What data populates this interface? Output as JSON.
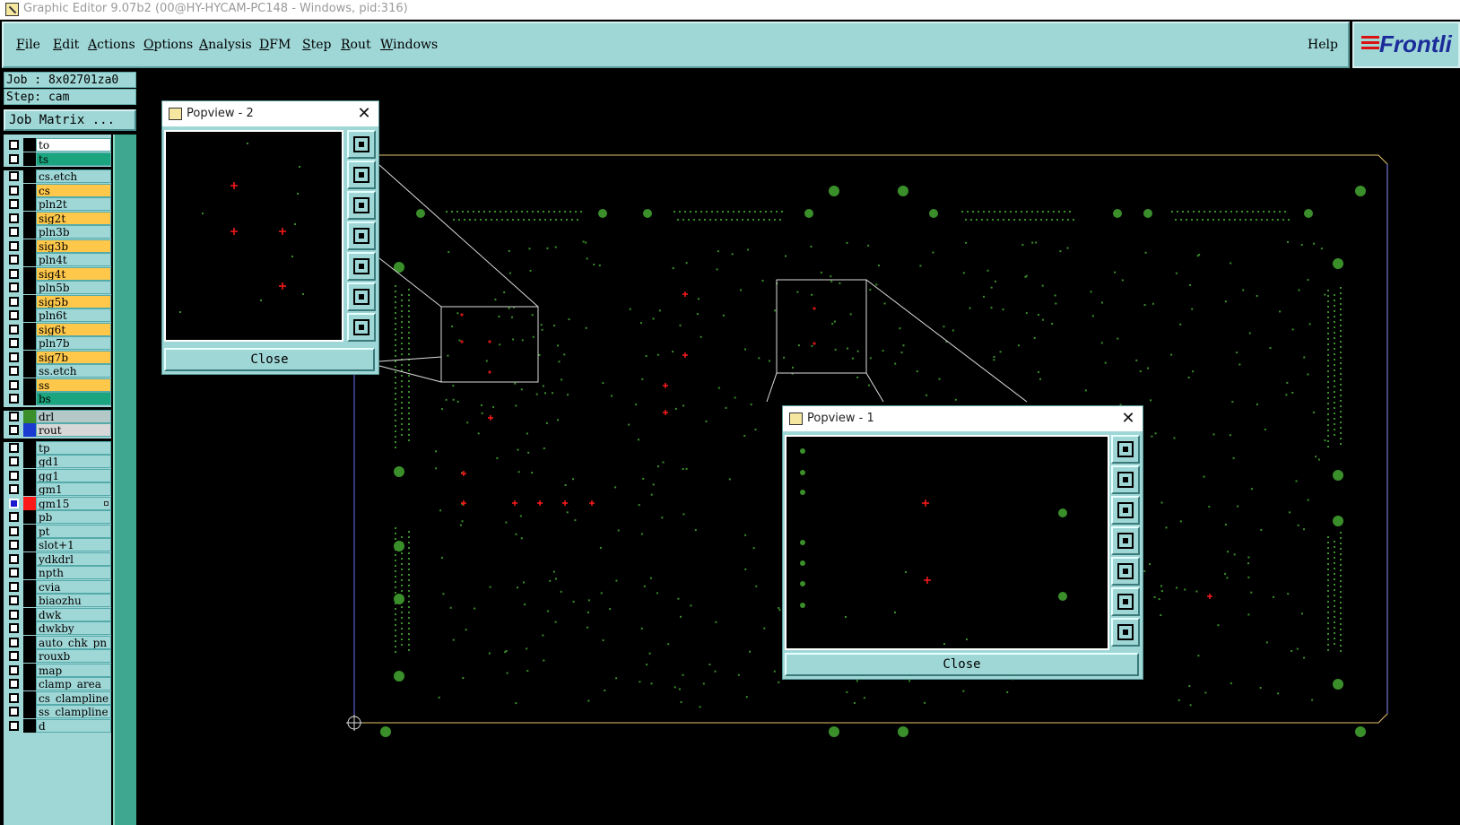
{
  "window": {
    "title": "Graphic Editor 9.07b2 (00@HY-HYCAM-PC148 - Windows, pid:316)"
  },
  "menu": {
    "items": [
      {
        "label": "File",
        "underline": "F"
      },
      {
        "label": "Edit",
        "underline": "E"
      },
      {
        "label": "Actions",
        "underline": "A"
      },
      {
        "label": "Options",
        "underline": "O"
      },
      {
        "label": "Analysis",
        "underline": "A"
      },
      {
        "label": "DFM",
        "underline": "D"
      },
      {
        "label": "Step",
        "underline": "S"
      },
      {
        "label": "Rout",
        "underline": "R"
      },
      {
        "label": "Windows",
        "underline": "W"
      }
    ],
    "help": "Help",
    "logo": "Frontli"
  },
  "job": {
    "job_line": "Job : 8x02701za0",
    "step_line": "Step: cam",
    "matrix_button": "Job Matrix ..."
  },
  "layers": [
    {
      "name": "to",
      "bg": "#ffffff",
      "swatch": "#000000"
    },
    {
      "name": "ts",
      "bg": "#1aa57e",
      "swatch": "#000000"
    },
    {
      "name": "cs.etch",
      "bg": "#9fd6d6",
      "swatch": "#000000"
    },
    {
      "name": "cs",
      "bg": "#ffc84a",
      "swatch": "#000000"
    },
    {
      "name": "pln2t",
      "bg": "#9fd6d6",
      "swatch": "#000000"
    },
    {
      "name": "sig2t",
      "bg": "#ffc84a",
      "swatch": "#000000"
    },
    {
      "name": "pln3b",
      "bg": "#9fd6d6",
      "swatch": "#000000"
    },
    {
      "name": "sig3b",
      "bg": "#ffc84a",
      "swatch": "#000000"
    },
    {
      "name": "pln4t",
      "bg": "#9fd6d6",
      "swatch": "#000000"
    },
    {
      "name": "sig4t",
      "bg": "#ffc84a",
      "swatch": "#000000"
    },
    {
      "name": "pln5b",
      "bg": "#9fd6d6",
      "swatch": "#000000"
    },
    {
      "name": "sig5b",
      "bg": "#ffc84a",
      "swatch": "#000000"
    },
    {
      "name": "pln6t",
      "bg": "#9fd6d6",
      "swatch": "#000000"
    },
    {
      "name": "sig6t",
      "bg": "#ffc84a",
      "swatch": "#000000"
    },
    {
      "name": "pln7b",
      "bg": "#9fd6d6",
      "swatch": "#000000"
    },
    {
      "name": "sig7b",
      "bg": "#ffc84a",
      "swatch": "#000000"
    },
    {
      "name": "ss.etch",
      "bg": "#9fd6d6",
      "swatch": "#000000"
    },
    {
      "name": "ss",
      "bg": "#ffc84a",
      "swatch": "#000000"
    },
    {
      "name": "bs",
      "bg": "#1aa57e",
      "swatch": "#000000"
    },
    {
      "name": "drl",
      "bg": "#b4c8c8",
      "swatch": "#3a8f2a"
    },
    {
      "name": "rout",
      "bg": "#d8d8d8",
      "swatch": "#1a3ad0"
    },
    {
      "name": "tp",
      "bg": "#9fd6d6",
      "swatch": "#000000"
    },
    {
      "name": "gd1",
      "bg": "#9fd6d6",
      "swatch": "#000000"
    },
    {
      "name": "gg1",
      "bg": "#9fd6d6",
      "swatch": "#000000"
    },
    {
      "name": "gm1",
      "bg": "#9fd6d6",
      "swatch": "#000000"
    },
    {
      "name": "gm15",
      "bg": "#9fd6d6",
      "swatch": "#ff1a1a",
      "checked": true
    },
    {
      "name": "pb",
      "bg": "#9fd6d6",
      "swatch": "#000000"
    },
    {
      "name": "pt",
      "bg": "#9fd6d6",
      "swatch": "#000000"
    },
    {
      "name": "slot+1",
      "bg": "#9fd6d6",
      "swatch": "#000000"
    },
    {
      "name": "ydkdrl",
      "bg": "#9fd6d6",
      "swatch": "#000000"
    },
    {
      "name": "npth",
      "bg": "#9fd6d6",
      "swatch": "#000000"
    },
    {
      "name": "cvia",
      "bg": "#9fd6d6",
      "swatch": "#000000"
    },
    {
      "name": "biaozhu",
      "bg": "#9fd6d6",
      "swatch": "#000000"
    },
    {
      "name": "dwk",
      "bg": "#9fd6d6",
      "swatch": "#000000"
    },
    {
      "name": "dwkby",
      "bg": "#9fd6d6",
      "swatch": "#000000"
    },
    {
      "name": "auto_chk_pn",
      "bg": "#9fd6d6",
      "swatch": "#000000"
    },
    {
      "name": "rouxb",
      "bg": "#9fd6d6",
      "swatch": "#000000"
    },
    {
      "name": "map",
      "bg": "#9fd6d6",
      "swatch": "#000000"
    },
    {
      "name": "clamp_area",
      "bg": "#9fd6d6",
      "swatch": "#000000"
    },
    {
      "name": "cs_clampline",
      "bg": "#9fd6d6",
      "swatch": "#000000"
    },
    {
      "name": "ss_clampline",
      "bg": "#9fd6d6",
      "swatch": "#000000"
    },
    {
      "name": "d",
      "bg": "#9fd6d6",
      "swatch": "#000000"
    }
  ],
  "popview2": {
    "title": "Popview - 2",
    "close_x": "✕",
    "close_label": "Close"
  },
  "popview1": {
    "title": "Popview - 1",
    "close_x": "✕",
    "close_label": "Close"
  },
  "colors": {
    "panel": "#9fd6d6",
    "pad_green": "#3a8f2a",
    "marker_red": "#ff1a1a",
    "board_outline": "#e6c36a"
  }
}
